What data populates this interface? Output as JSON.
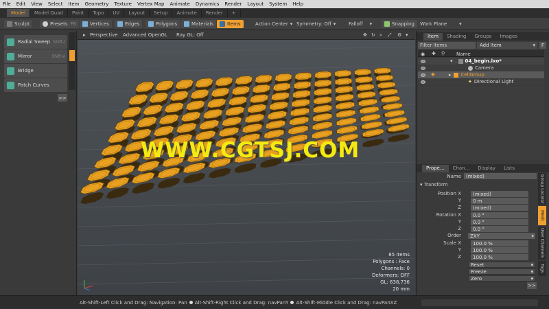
{
  "menubar": [
    "File",
    "Edit",
    "View",
    "Select",
    "Item",
    "Geometry",
    "Texture",
    "Vertex Map",
    "Animate",
    "Dynamics",
    "Render",
    "Layout",
    "System",
    "Help"
  ],
  "layout_tabs": [
    {
      "label": "Model",
      "active": true
    },
    {
      "label": "Model Quad",
      "active": false
    },
    {
      "label": "Paint",
      "active": false
    },
    {
      "label": "Topo",
      "active": false
    },
    {
      "label": "UV",
      "active": false
    },
    {
      "label": "Layout",
      "active": false
    },
    {
      "label": "Setup",
      "active": false
    },
    {
      "label": "Animate",
      "active": false
    },
    {
      "label": "Render",
      "active": false
    },
    {
      "label": "+",
      "active": false
    }
  ],
  "toolbar": {
    "sculpt": "Sculpt",
    "presets": "Presets",
    "presets_shortcut": "F6",
    "vertices": "Vertices",
    "edges": "Edges",
    "polygons": "Polygons",
    "materials": "Materials",
    "items": "Items",
    "action_center": "Action Center",
    "symmetry": "Symmetry: Off",
    "falloff": "Falloff",
    "snapping": "Snapping",
    "work_plane": "Work Plane"
  },
  "left_tools": [
    {
      "label": "Radial Sweep",
      "shortcut": "Shift-I"
    },
    {
      "label": "Mirror",
      "shortcut": "Shift-V"
    },
    {
      "label": "Bridge",
      "shortcut": ""
    },
    {
      "label": "Patch Curves",
      "shortcut": ""
    }
  ],
  "left_more": ">>",
  "viewport": {
    "view": "Perspective",
    "shading": "Advanced OpenGL",
    "raygl": "Ray GL: Off",
    "watermark": "WWW.CGTSJ.COM",
    "stats": [
      "85 Items",
      "Polygons : Face",
      "Channels: 0",
      "Deformers: OFF",
      "GL: 638,736",
      "20 mm"
    ]
  },
  "status_bar": {
    "a": "Alt-Shift-Left Click and Drag: Navigation: Pan",
    "b": "Alt-Shift-Right Click and Drag: navPanY",
    "c": "Alt-Shift-Middle Click and Drag: navPanXZ"
  },
  "items_panel": {
    "tabs": [
      "Item",
      "Shading",
      "Groups",
      "Images"
    ],
    "filter": "Filter Items",
    "add_item": "Add Item",
    "f_button": "F",
    "column_name": "Name",
    "rows": [
      {
        "name": "04_begin.lxo*",
        "indent": 0
      },
      {
        "name": "Camera",
        "indent": 1
      },
      {
        "name": "CellGroup",
        "indent": 1
      },
      {
        "name": "Directional Light",
        "indent": 1
      }
    ]
  },
  "properties_panel": {
    "tabs": [
      "Prope...",
      "Chan...",
      "Display",
      "Lists"
    ],
    "name_label": "Name",
    "name_value": "(mixed)",
    "section": "Transform",
    "position_label": "Position",
    "rotation_label": "Rotation",
    "order_label": "Order",
    "scale_label": "Scale",
    "axis": [
      "X",
      "Y",
      "Z"
    ],
    "position": [
      "(mixed)",
      "0 m",
      "(mixed)"
    ],
    "rotation": [
      "0.0 °",
      "0.0 °",
      "0.0 °"
    ],
    "order": "ZXY",
    "scale": [
      "100.0 %",
      "100.0 %",
      "100.0 %"
    ],
    "reset": "Reset",
    "freeze": "Freeze",
    "zero": "Zero",
    "more": ">>",
    "side_tabs": [
      "Group Locator",
      "Mesh",
      "User Channels",
      "Tags"
    ]
  },
  "colors": {
    "accent": "#f0a030",
    "cell": "#e8a020"
  }
}
